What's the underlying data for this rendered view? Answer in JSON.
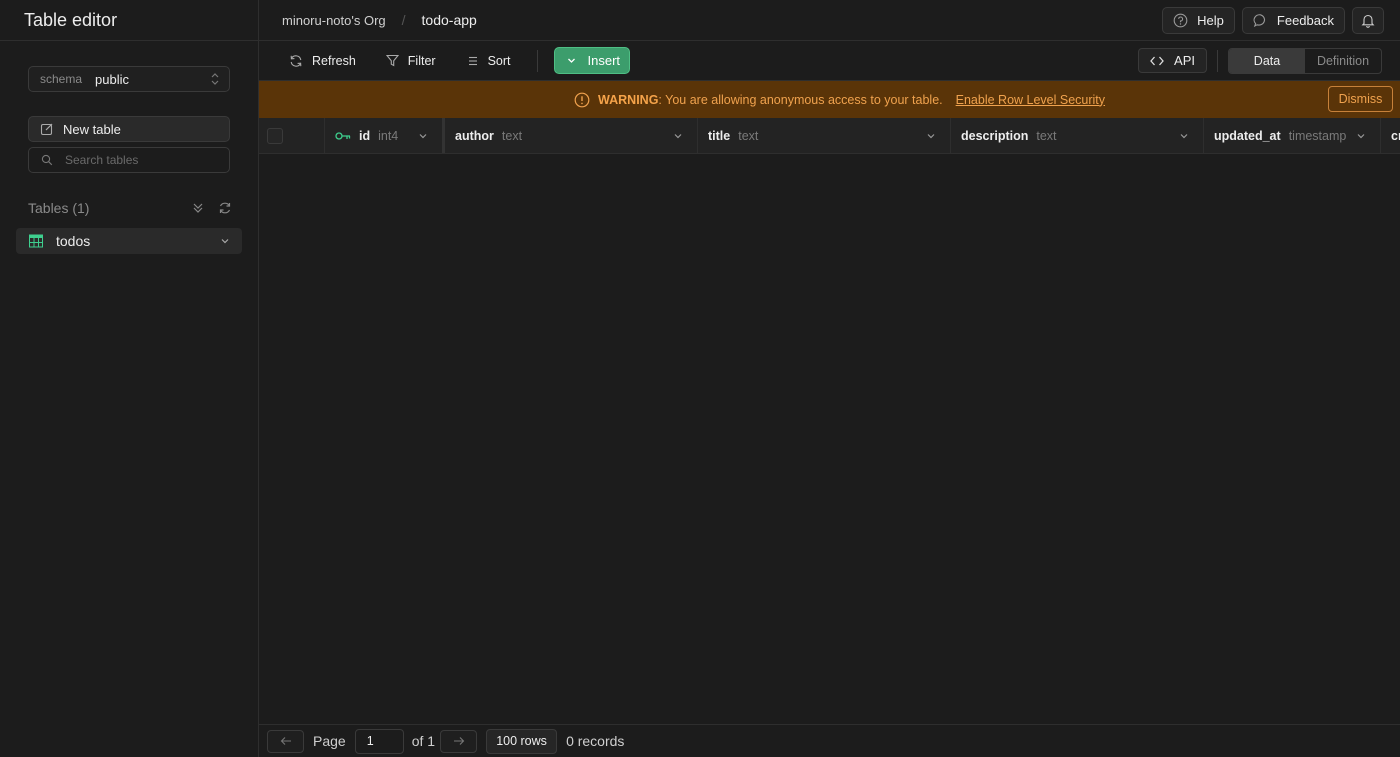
{
  "sidebar": {
    "title": "Table editor",
    "schema_label": "schema",
    "schema_value": "public",
    "new_table_label": "New table",
    "search_placeholder": "Search tables",
    "tables_header": "Tables (1)",
    "tables": [
      {
        "name": "todos"
      }
    ]
  },
  "topbar": {
    "org": "minoru-noto's Org",
    "separator": "/",
    "project": "todo-app",
    "help_label": "Help",
    "feedback_label": "Feedback"
  },
  "toolbar": {
    "refresh_label": "Refresh",
    "filter_label": "Filter",
    "sort_label": "Sort",
    "insert_label": "Insert",
    "api_label": "API",
    "view_tabs": [
      "Data",
      "Definition"
    ],
    "active_tab": "Data"
  },
  "warning": {
    "strong": "WARNING",
    "message": ": You are allowing anonymous access to your table.",
    "link": "Enable Row Level Security",
    "dismiss_label": "Dismiss"
  },
  "columns": [
    {
      "name": "id",
      "type": "int4",
      "primary_key": true
    },
    {
      "name": "author",
      "type": "text"
    },
    {
      "name": "title",
      "type": "text"
    },
    {
      "name": "description",
      "type": "text"
    },
    {
      "name": "updated_at",
      "type": "timestamp"
    },
    {
      "name": "cre",
      "type": ""
    }
  ],
  "footer": {
    "page_label": "Page",
    "page_value": "1",
    "of_label": "of 1",
    "rows_label": "100 rows",
    "records_label": "0 records"
  },
  "colors": {
    "accent": "#3c9d6c",
    "warning_bg": "#5a3408",
    "warning_text": "#f0a24e",
    "table_icon": "#3ecf8e"
  }
}
